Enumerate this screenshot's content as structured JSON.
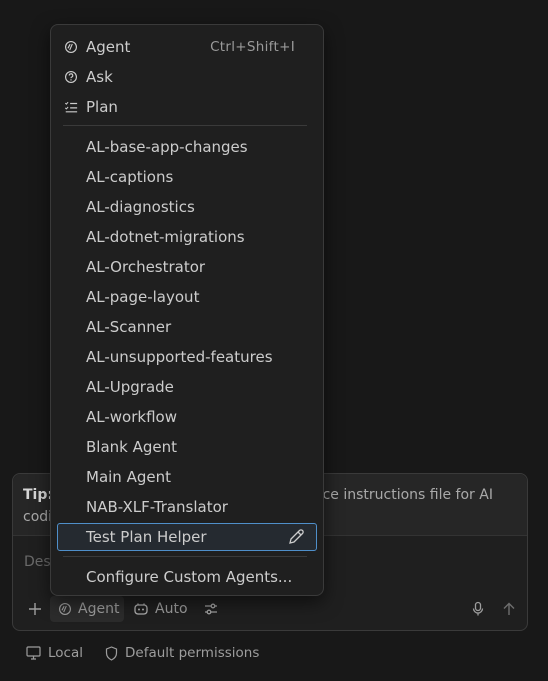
{
  "menu": {
    "modes": [
      {
        "label": "Agent",
        "shortcut": "Ctrl+Shift+I",
        "icon": "agent-icon"
      },
      {
        "label": "Ask",
        "icon": "ask-icon"
      },
      {
        "label": "Plan",
        "icon": "plan-icon"
      }
    ],
    "custom_agents": [
      "AL-base-app-changes",
      "AL-captions",
      "AL-diagnostics",
      "AL-dotnet-migrations",
      "AL-Orchestrator",
      "AL-page-layout",
      "AL-Scanner",
      "AL-unsupported-features",
      "AL-Upgrade",
      "AL-workflow",
      "Blank Agent",
      "Main Agent",
      "NAB-XLF-Translator",
      "Test Plan Helper"
    ],
    "selected_agent": "Test Plan Helper",
    "configure_label": "Configure Custom Agents...",
    "colors": {
      "selection_border": "#4f8fca",
      "background": "#1f1f1f"
    }
  },
  "chat": {
    "tip_label": "Tip:",
    "tip_text_visible_right": "ace instructions file for AI",
    "tip_text_visible_left": "codi",
    "input_placeholder": "Des",
    "mode_button_label": "Agent",
    "model_button_label": "Auto"
  },
  "status": {
    "location_label": "Local",
    "permissions_label": "Default permissions"
  }
}
